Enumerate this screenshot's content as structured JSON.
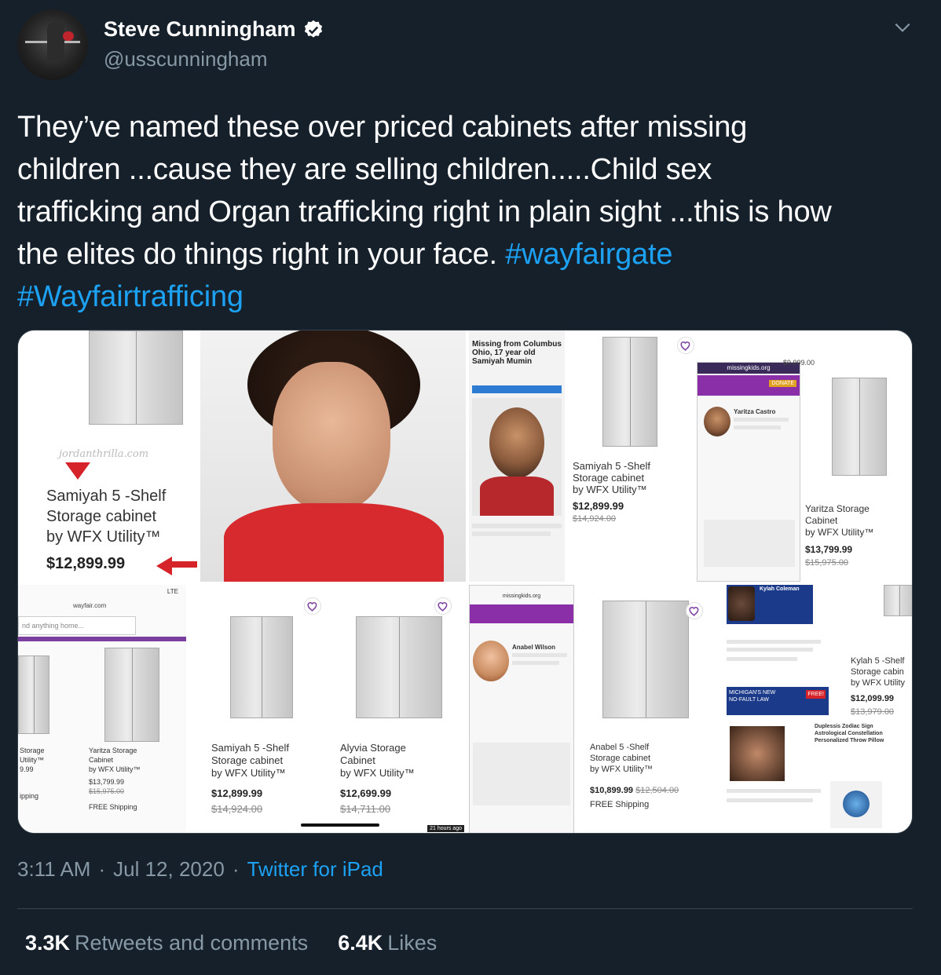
{
  "user": {
    "name": "Steve Cunningham",
    "handle": "@usscunningham"
  },
  "tweet": {
    "lines": [
      "They’ve named these over priced  cabinets after missing",
      "children ...cause they are selling  children.....Child sex",
      "trafficking and Organ trafficking right in plain sight ...this is how",
      "the elites do things right in your face. "
    ],
    "hashtag1": "#wayfairgate",
    "hashtag2": "#Wayfairtrafficing"
  },
  "media": {
    "p1": {
      "watermark": "jordanthrilla.com",
      "product_l1": "Samiyah 5 -Shelf",
      "product_l2": "Storage cabinet",
      "product_l3": "by WFX Utility™",
      "price": "$12,899.99"
    },
    "p2": {
      "missing_l1": "Missing from Columbus",
      "missing_l2": "Ohio, 17 year old",
      "missing_l3": "Samiyah Mumin",
      "product_l1": "Samiyah 5 -Shelf",
      "product_l2": "Storage cabinet",
      "product_l3": "by WFX Utility™",
      "price": "$12,899.99",
      "old_price": "$14,924.00",
      "top_price": "$9,999.00",
      "site": "missingkids.org",
      "donate": "DONATE",
      "person_name": "Yaritza Castro",
      "product2_l1": "Yaritza Storage",
      "product2_l2": "Cabinet",
      "product2_l3": "by WFX Utility™",
      "price2": "$13,799.99",
      "old_price2": "$15,975.00"
    },
    "p3": {
      "url": "wayfair.com",
      "search_placeholder": "nd anything home...",
      "status": "LTE",
      "a_l1": "Storage",
      "a_l2": "Utility™",
      "a_price": "9.99",
      "a_ship": "ipping",
      "b_l1": "Yaritza Storage",
      "b_l2": "Cabinet",
      "b_l3": "by WFX Utility™",
      "b_price": "$13,799.99",
      "b_old": "$15,975.00",
      "b_ship": "FREE Shipping",
      "c_l1": "Samiyah 5 -Shelf",
      "c_l2": "Storage cabinet",
      "c_l3": "by WFX Utility™",
      "c_price": "$12,899.99",
      "c_old": "$14,924.00",
      "d_l1": "Alyvia Storage",
      "d_l2": "Cabinet",
      "d_l3": "by WFX Utility™",
      "d_price": "$12,699.99",
      "d_old": "$14,711.00",
      "timestamp": "21 hours ago"
    },
    "p4": {
      "site": "missingkids.org",
      "person_name": "Anabel Wilson",
      "product_l1": "Anabel 5 -Shelf",
      "product_l2": "Storage cabinet",
      "product_l3": "by WFX Utility™",
      "price": "$10,899.99",
      "old_price": "$12,504.00",
      "ship": "FREE Shipping",
      "news_name": "Kylah Coleman",
      "news_l1": "MICHIGAN'S NEW",
      "news_l2": "NO-FAULT LAW",
      "free": "FREE!",
      "pillow_l1": "Duplessis Zodiac Sign",
      "pillow_l2": "Astrological Constellation",
      "pillow_l3": "Personalized Throw Pillow",
      "product2_l1": "Kylah 5 -Shelf",
      "product2_l2": "Storage cabin",
      "product2_l3": "by WFX Utility",
      "price2": "$12,099.99",
      "old_price2": "$13,979.00"
    }
  },
  "meta": {
    "time": "3:11 AM",
    "sep": "·",
    "date": "Jul 12, 2020",
    "sep2": "·",
    "app": "Twitter for iPad"
  },
  "stats": {
    "retweets_num": "3.3K",
    "retweets_label": "Retweets and comments",
    "likes_num": "6.4K",
    "likes_label": "Likes"
  },
  "colors": {
    "background": "#15202b",
    "link": "#1da1f2",
    "muted": "#8899a6"
  }
}
